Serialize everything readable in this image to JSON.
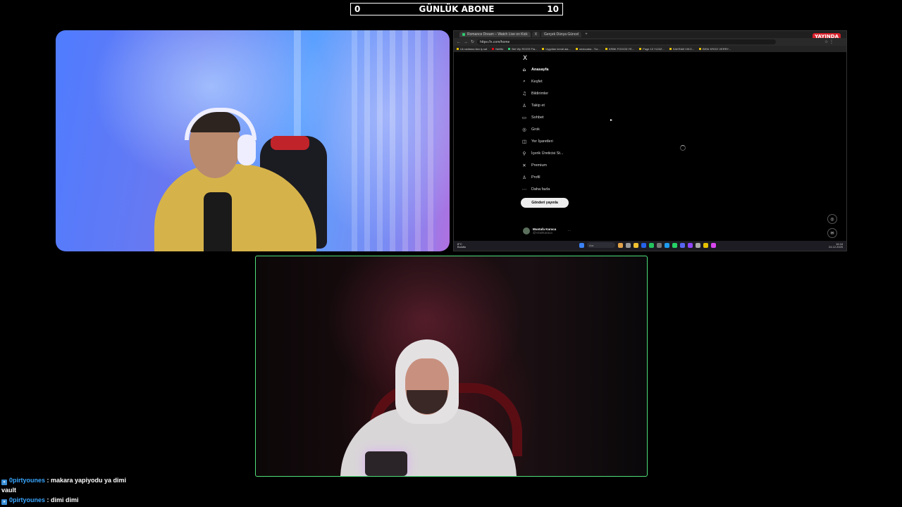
{
  "counter": {
    "left_value": "0",
    "title": "GÜNLÜK ABONE",
    "right_value": "10"
  },
  "screen_share": {
    "tabs": [
      {
        "label": "Romance Dream – Watch Live on Kick"
      },
      {
        "label": "X"
      },
      {
        "label": "Gerçek Dünya Güncel"
      }
    ],
    "tab_add": "+",
    "live_badge": "YAYINDA",
    "url": "https://x.com/home",
    "bookmarks": [
      "Uk radlama ilan iş sat",
      "Netflix",
      "Bet Wp ROGS Fla...",
      "Uygıtları kendi ala...",
      "nedocaba - Tur...",
      "KRBK FOOOD YE...",
      "Page 10 YLDIZ...",
      "SAKRAB VIKO...",
      "BENI KROO VERRY..."
    ],
    "x_logo": "X",
    "nav": [
      {
        "label": "Anasayfa",
        "icon": "home-icon",
        "glyph": "⌂"
      },
      {
        "label": "Keşfet",
        "icon": "search-icon",
        "glyph": "⌕"
      },
      {
        "label": "Bildirimler",
        "icon": "bell-icon",
        "glyph": "♫"
      },
      {
        "label": "Takip et",
        "icon": "follow-icon",
        "glyph": "♙"
      },
      {
        "label": "Sohbet",
        "icon": "chat-icon",
        "glyph": "▭"
      },
      {
        "label": "Grok",
        "icon": "grok-icon",
        "glyph": "◎"
      },
      {
        "label": "Yer İşaretleri",
        "icon": "bookmark-icon",
        "glyph": "◫"
      },
      {
        "label": "İçerik Üreticisi St...",
        "icon": "creator-icon",
        "glyph": "⚲"
      },
      {
        "label": "Premium",
        "icon": "premium-icon",
        "glyph": "✕"
      },
      {
        "label": "Profil",
        "icon": "profile-icon",
        "glyph": "♙"
      },
      {
        "label": "Daha fazla",
        "icon": "more-icon",
        "glyph": "⋯"
      }
    ],
    "post_button": "Gönderi yayınla",
    "profile": {
      "name": "Mustafa Karaca",
      "handle": "@ViralKaraca",
      "more": "···"
    },
    "taskbar": {
      "weather_temp": "8°C",
      "weather_desc": "Bulutlu",
      "search_placeholder": "Ara",
      "time": "16:18",
      "date": "24.12.2025"
    }
  },
  "chat": [
    {
      "user": "0pirtyounes",
      "sep": " : ",
      "message": "makara yapiyodu ya dimi",
      "continuation": "vault"
    },
    {
      "user": "0pirtyounes",
      "sep": " : ",
      "message": "dimi dimi",
      "continuation": ""
    }
  ],
  "colors": {
    "chat_user": "#39a6ff",
    "live_badge": "#d8202a",
    "bottom_cam_border": "#4fe07a"
  }
}
